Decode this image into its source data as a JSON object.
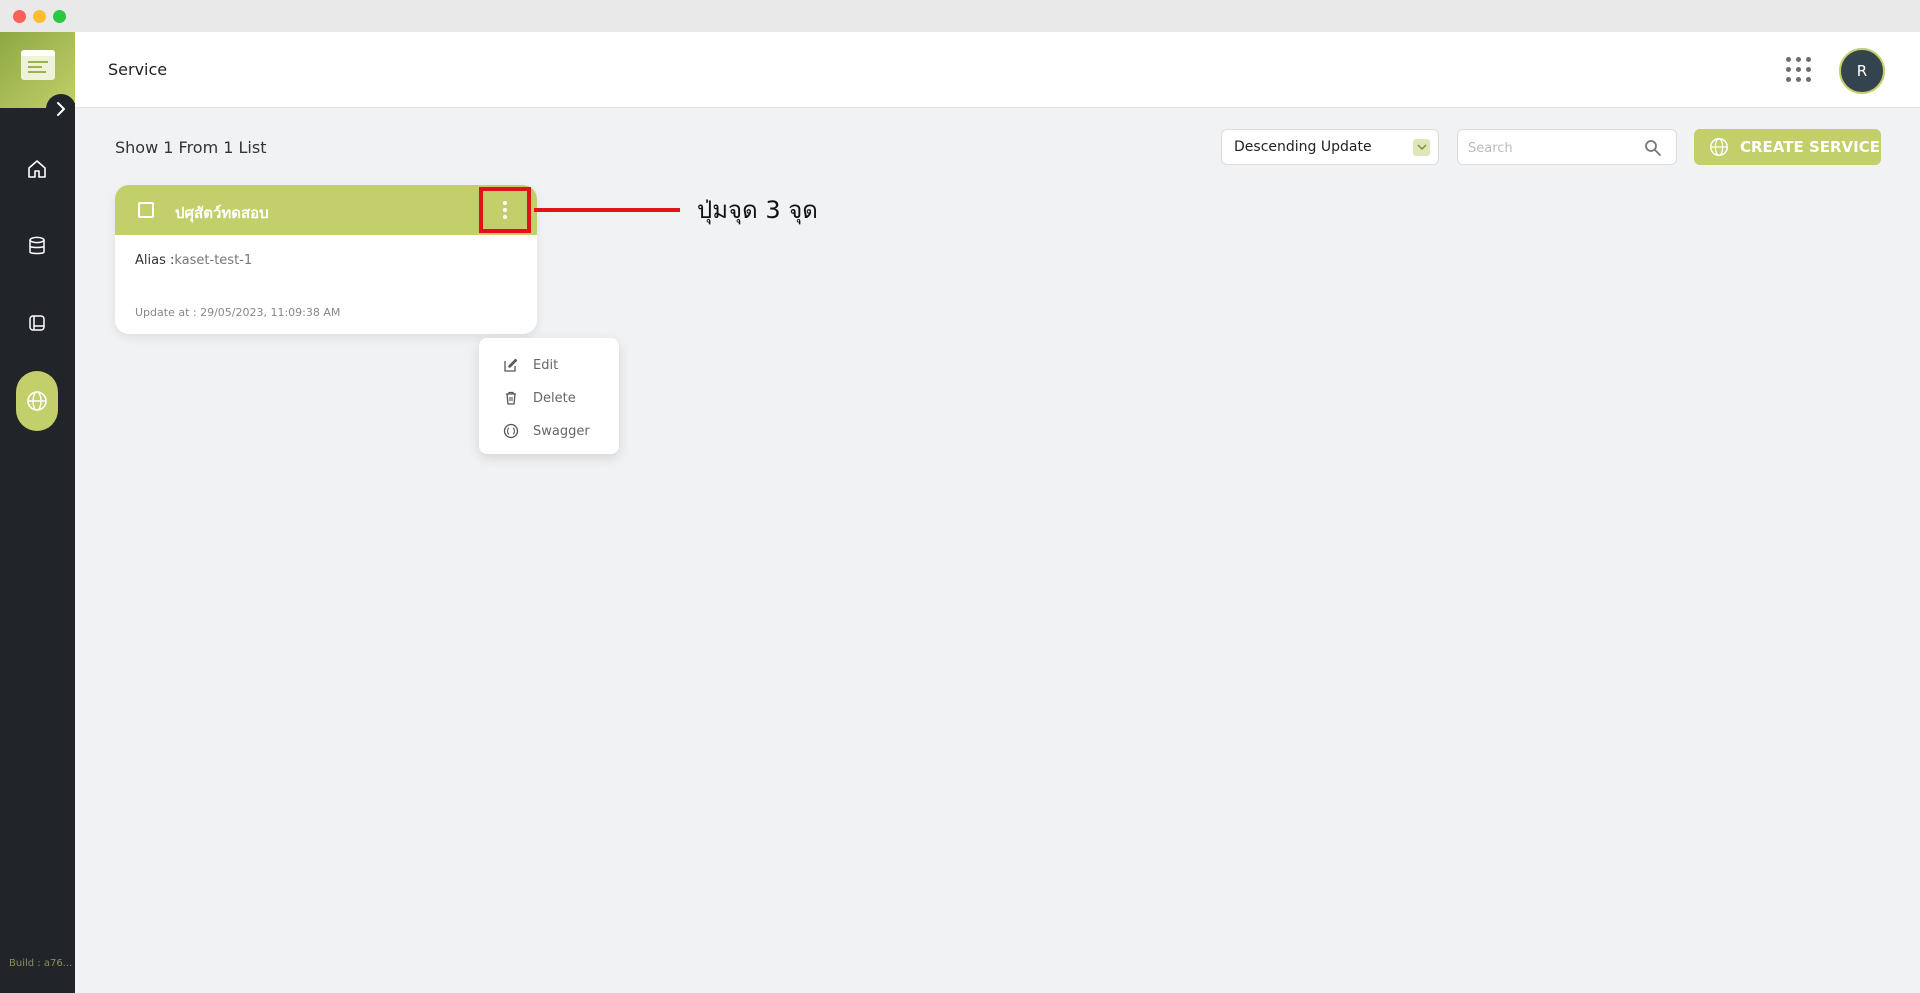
{
  "header": {
    "title": "Service",
    "avatar_initial": "R"
  },
  "sidebar": {
    "items": [
      {
        "icon": "home-icon"
      },
      {
        "icon": "database-icon"
      },
      {
        "icon": "book-icon"
      },
      {
        "icon": "globe-icon",
        "active": true
      }
    ],
    "build": "Build : a76..."
  },
  "toolbar": {
    "show_count": "Show 1 From 1 List",
    "sort_value": "Descending Update",
    "search_placeholder": "Search",
    "create_label": "CREATE SERVICE"
  },
  "cards": [
    {
      "title": "ปศุสัตว์ทดสอบ",
      "alias_label": "Alias :",
      "alias_value": "kaset-test-1",
      "update": "Update at : 29/05/2023, 11:09:38 AM"
    }
  ],
  "menu": {
    "items": [
      {
        "label": "Edit",
        "icon": "edit-icon"
      },
      {
        "label": "Delete",
        "icon": "trash-icon"
      },
      {
        "label": "Swagger",
        "icon": "swagger-icon"
      }
    ]
  },
  "annotation": {
    "text": "ปุ่มจุด 3 จุด"
  },
  "colors": {
    "accent": "#c2cf6a",
    "sidebar": "#212529",
    "highlight": "#e3121a"
  }
}
